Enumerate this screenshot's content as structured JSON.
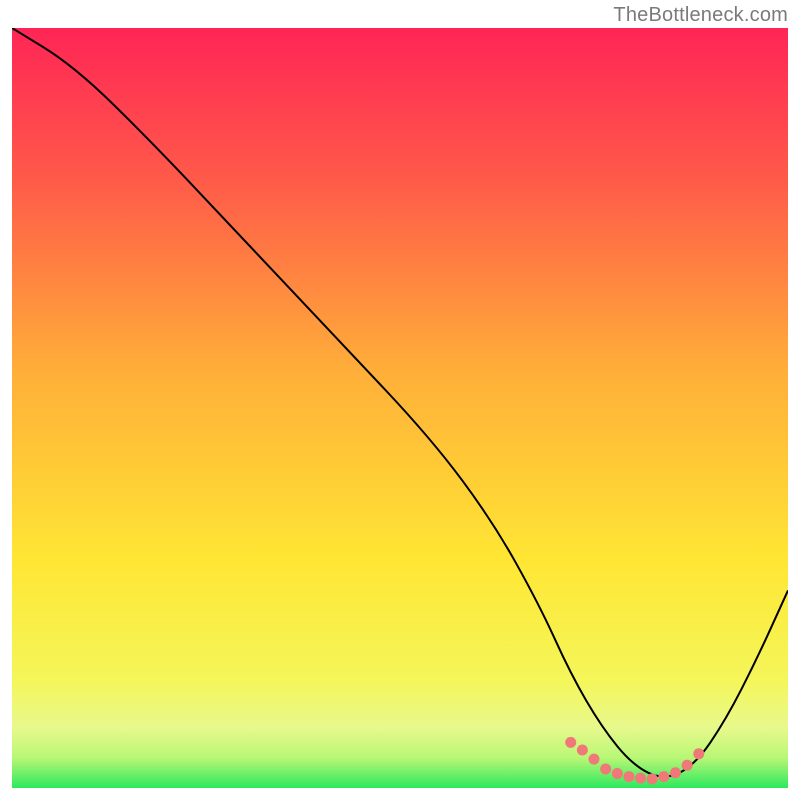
{
  "watermark": "TheBottleneck.com",
  "chart_data": {
    "type": "line",
    "title": "",
    "xlabel": "",
    "ylabel": "",
    "xlim": [
      0,
      100
    ],
    "ylim": [
      0,
      100
    ],
    "series": [
      {
        "name": "bottleneck-curve",
        "color": "#000000",
        "x": [
          0,
          8,
          18,
          30,
          42,
          54,
          62,
          68,
          72,
          76,
          80,
          84,
          88,
          92,
          96,
          100
        ],
        "y": [
          100,
          95,
          85,
          72,
          59,
          46,
          35,
          24,
          15,
          8,
          3,
          1,
          3,
          9,
          17,
          26
        ]
      },
      {
        "name": "optimal-marker",
        "type": "scatter",
        "color": "#f07878",
        "x": [
          72,
          73.5,
          75,
          76.5,
          78,
          79.5,
          81,
          82.5,
          84,
          85.5,
          87,
          88.5
        ],
        "y": [
          6.0,
          5.0,
          3.8,
          2.5,
          1.9,
          1.5,
          1.3,
          1.2,
          1.5,
          2.0,
          3.0,
          4.5
        ]
      }
    ],
    "gradient_stops": [
      {
        "offset": 0,
        "color": "#ff2556"
      },
      {
        "offset": 20,
        "color": "#ff5a49"
      },
      {
        "offset": 45,
        "color": "#ffae39"
      },
      {
        "offset": 70,
        "color": "#ffe634"
      },
      {
        "offset": 86,
        "color": "#f4f65a"
      },
      {
        "offset": 92,
        "color": "#e8f98c"
      },
      {
        "offset": 96,
        "color": "#b9f776"
      },
      {
        "offset": 100,
        "color": "#2ee85e"
      }
    ]
  }
}
